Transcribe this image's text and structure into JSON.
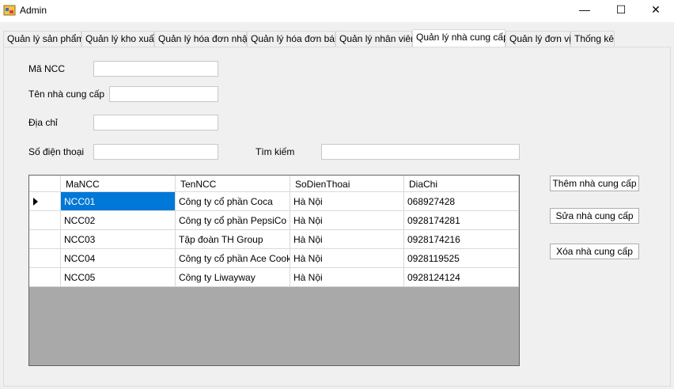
{
  "window": {
    "title": "Admin",
    "minimize_glyph": "—",
    "maximize_glyph": "☐",
    "close_glyph": "✕"
  },
  "tabs": [
    {
      "label": "Quản lý sản phẩm"
    },
    {
      "label": "Quản lý kho xuất"
    },
    {
      "label": "Quản lý hóa đơn nhập"
    },
    {
      "label": "Quản lý hóa đơn bán"
    },
    {
      "label": "Quản lý nhân viên"
    },
    {
      "label": "Quản lý nhà cung cấp",
      "active": true
    },
    {
      "label": "Quản lý đơn vị"
    },
    {
      "label": "Thống kê"
    }
  ],
  "form": {
    "mancc_label": "Mã NCC",
    "mancc_value": "",
    "tenncc_label": "Tên nhà cung cấp",
    "tenncc_value": "",
    "diachi_label": "Địa chỉ",
    "diachi_value": "",
    "sdt_label": "Số điện thoại",
    "sdt_value": "",
    "search_label": "Tìm kiếm",
    "search_value": ""
  },
  "grid": {
    "columns": [
      "MaNCC",
      "TenNCC",
      "SoDienThoai",
      "DiaChi"
    ],
    "rows": [
      [
        "NCC01",
        "Công ty cổ phần Coca",
        "Hà Nội",
        "068927428"
      ],
      [
        "NCC02",
        "Công ty cổ phần PepsiCo",
        "Hà Nội",
        "0928174281"
      ],
      [
        "NCC03",
        "Tập đoàn TH Group",
        "Hà Nội",
        "0928174216"
      ],
      [
        "NCC04",
        "Công ty cổ phần Ace Cook",
        "Hà Nội",
        "0928119525"
      ],
      [
        "NCC05",
        "Công ty Liwayway",
        "Hà Nội",
        "0928124124"
      ]
    ]
  },
  "buttons": {
    "add": "Thêm nhà cung cấp",
    "edit": "Sửa nhà cung cấp",
    "delete": "Xóa nhà cung cấp"
  },
  "colors": {
    "selection": "#0078d7",
    "grid_background": "#a9a9a9"
  }
}
